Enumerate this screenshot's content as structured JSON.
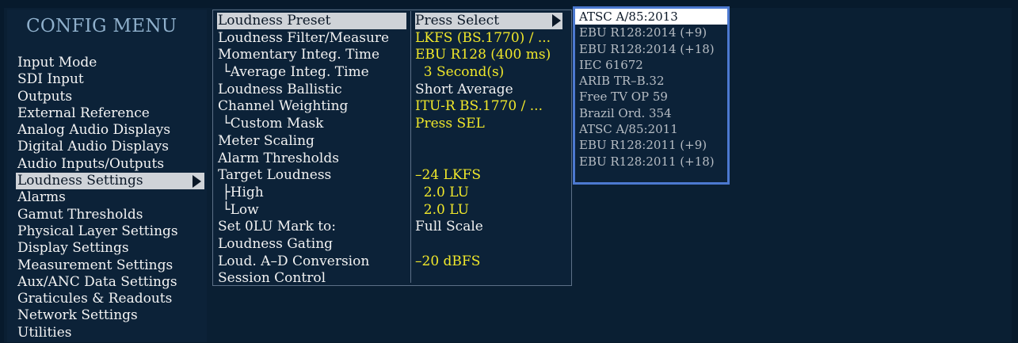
{
  "menu_title": "CONFIG MENU",
  "main_menu": [
    {
      "label": "Input Mode"
    },
    {
      "label": "SDI Input"
    },
    {
      "label": "Outputs"
    },
    {
      "label": "External Reference"
    },
    {
      "label": "Analog Audio Displays"
    },
    {
      "label": "Digital Audio Displays"
    },
    {
      "label": "Audio Inputs/Outputs"
    },
    {
      "label": "Loudness Settings",
      "selected": true
    },
    {
      "label": "Alarms"
    },
    {
      "label": "Gamut Thresholds"
    },
    {
      "label": "Physical Layer Settings"
    },
    {
      "label": "Display Settings"
    },
    {
      "label": "Measurement Settings"
    },
    {
      "label": "Aux/ANC Data Settings"
    },
    {
      "label": "Graticules & Readouts"
    },
    {
      "label": "Network Settings"
    },
    {
      "label": "Utilities"
    }
  ],
  "loudness_params": [
    {
      "name": "Loudness Preset",
      "value": "Press Select",
      "selected": true
    },
    {
      "name": "Loudness Filter/Measure",
      "value": "LKFS (BS.1770) / ..."
    },
    {
      "name": "Momentary Integ. Time",
      "value": "EBU R128 (400 ms)"
    },
    {
      "name": " └Average Integ. Time",
      "value": "  3 Second(s)"
    },
    {
      "name": "Loudness Ballistic",
      "value": "Short Average",
      "white": true
    },
    {
      "name": "Channel Weighting",
      "value": "ITU-R BS.1770 / ..."
    },
    {
      "name": " └Custom Mask",
      "value": "Press SEL"
    },
    {
      "name": "Meter Scaling",
      "value": ""
    },
    {
      "name": "Alarm Thresholds",
      "value": ""
    },
    {
      "name": "Target Loudness",
      "value": "–24 LKFS"
    },
    {
      "name": " ├High",
      "value": "  2.0 LU"
    },
    {
      "name": " └Low",
      "value": "  2.0 LU"
    },
    {
      "name": "Set 0LU Mark to:",
      "value": "Full Scale",
      "white": true
    },
    {
      "name": "Loudness Gating",
      "value": ""
    },
    {
      "name": "Loud. A–D Conversion",
      "value": "–20 dBFS"
    },
    {
      "name": "Session Control",
      "value": ""
    }
  ],
  "preset_options": [
    {
      "label": "ATSC A/85:2013",
      "selected": true
    },
    {
      "label": "EBU R128:2014 (+9)"
    },
    {
      "label": "EBU R128:2014 (+18)"
    },
    {
      "label": "IEC 61672"
    },
    {
      "label": "ARIB TR–B.32"
    },
    {
      "label": "Free TV OP 59"
    },
    {
      "label": "Brazil Ord. 354"
    },
    {
      "label": "ATSC A/85:2011"
    },
    {
      "label": "EBU R128:2011 (+9)"
    },
    {
      "label": "EBU R128:2011 (+18)"
    }
  ],
  "colors": {
    "background": "#071a2c",
    "highlight": "#cfd3d8",
    "value_yellow": "#f1e82a",
    "dropdown_border": "#4c79d0",
    "title_blue": "#8fb0cc"
  }
}
